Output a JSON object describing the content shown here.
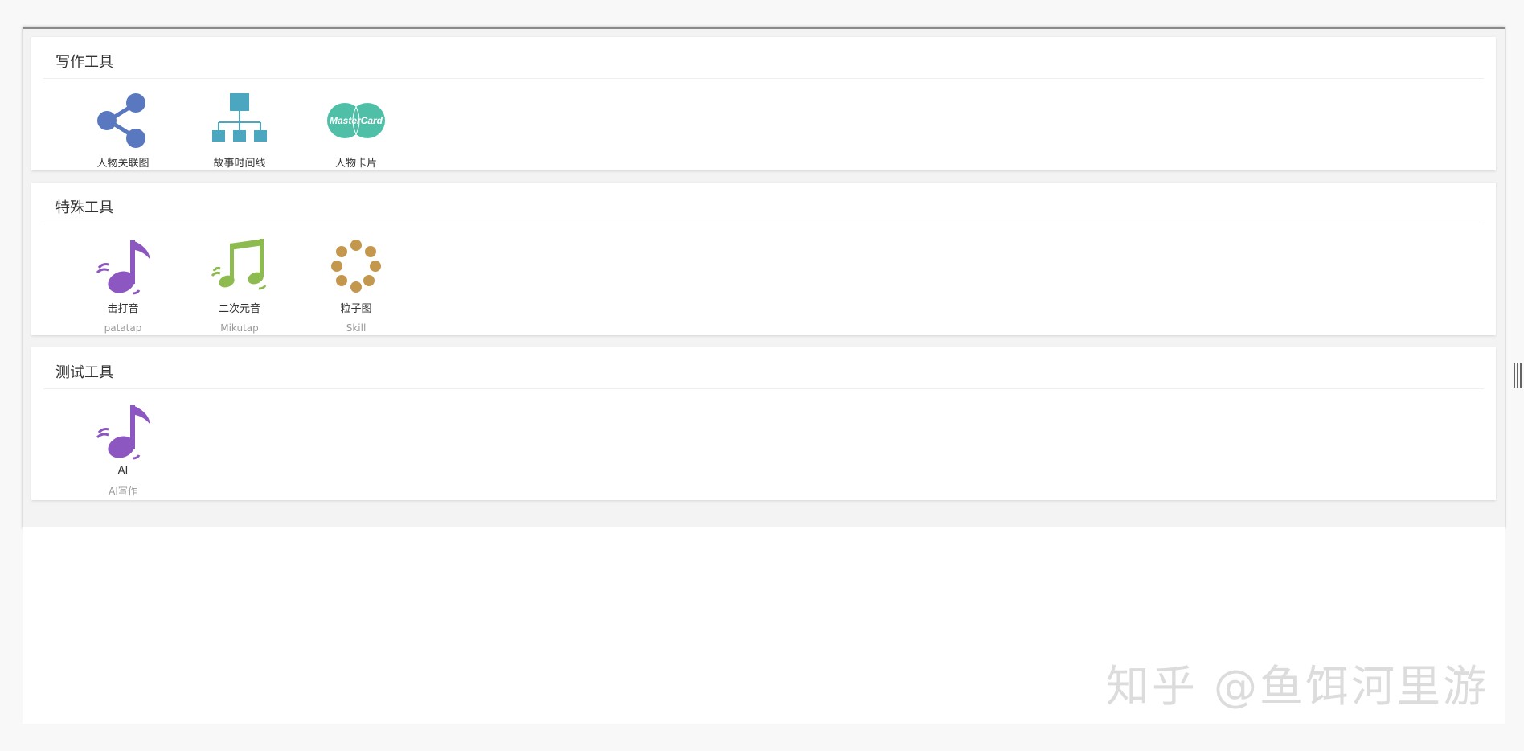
{
  "sections": [
    {
      "title": "写作工具",
      "tools": [
        {
          "label": "人物关联图",
          "icon": "share-nodes-icon",
          "color": "#5a78c0"
        },
        {
          "label": "故事时间线",
          "icon": "org-chart-icon",
          "color": "#4ba6c0"
        },
        {
          "label": "人物卡片",
          "icon": "mastercard-icon",
          "color": "#4fbfa7",
          "icon_text": "MasterCard"
        }
      ]
    },
    {
      "title": "特殊工具",
      "tools": [
        {
          "label": "击打音",
          "sub": "patatap",
          "icon": "music-note-icon",
          "color": "#8c57c0"
        },
        {
          "label": "二次元音",
          "sub": "Mikutap",
          "icon": "double-music-note-icon",
          "color": "#8dbb4f"
        },
        {
          "label": "粒子图",
          "sub": "Skill",
          "icon": "particle-circle-icon",
          "color": "#c4974f"
        }
      ]
    },
    {
      "title": "测试工具",
      "tools": [
        {
          "label": "AI",
          "sub": "AI写作",
          "icon": "music-note-icon",
          "color": "#8c57c0"
        }
      ]
    }
  ],
  "watermark": "知乎 @鱼饵河里游"
}
